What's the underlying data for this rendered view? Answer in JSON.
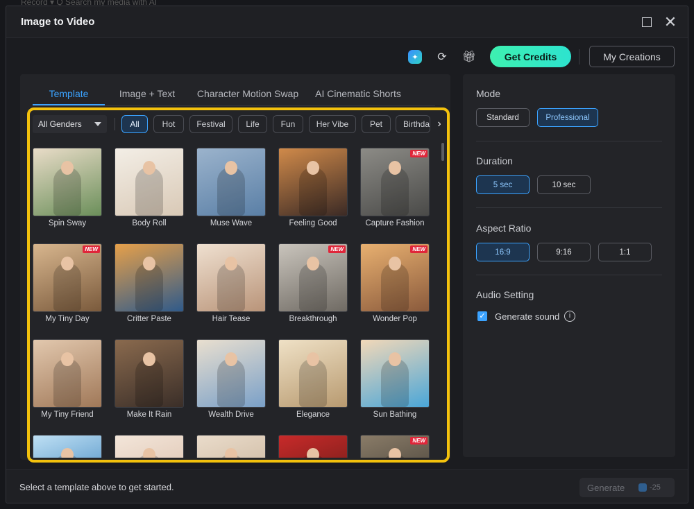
{
  "window": {
    "title": "Image to Video",
    "background_text": "Record ▾    Q  Search my media with AI"
  },
  "toolbar": {
    "credits_label": "Get Credits",
    "creations_label": "My Creations",
    "icons": [
      "ai-sparkle-icon",
      "refresh-icon",
      "gift-icon"
    ]
  },
  "tabs": [
    {
      "label": "Template",
      "active": true
    },
    {
      "label": "Image + Text",
      "active": false
    },
    {
      "label": "Character Motion Swap",
      "active": false
    },
    {
      "label": "AI Cinematic Shorts",
      "active": false
    }
  ],
  "filters": {
    "gender_select": "All Genders",
    "chips": [
      {
        "label": "All",
        "active": true
      },
      {
        "label": "Hot",
        "active": false
      },
      {
        "label": "Festival",
        "active": false
      },
      {
        "label": "Life",
        "active": false
      },
      {
        "label": "Fun",
        "active": false
      },
      {
        "label": "Her Vibe",
        "active": false
      },
      {
        "label": "Pet",
        "active": false
      },
      {
        "label": "Birthday",
        "active": false
      }
    ]
  },
  "templates": [
    {
      "label": "Spin Sway",
      "new": false
    },
    {
      "label": "Body Roll",
      "new": false
    },
    {
      "label": "Muse Wave",
      "new": false
    },
    {
      "label": "Feeling Good",
      "new": false
    },
    {
      "label": "Capture Fashion",
      "new": true
    },
    {
      "label": "My Tiny Day",
      "new": true
    },
    {
      "label": "Critter Paste",
      "new": false
    },
    {
      "label": "Hair Tease",
      "new": false
    },
    {
      "label": "Breakthrough",
      "new": true
    },
    {
      "label": "Wonder Pop",
      "new": true
    },
    {
      "label": "My Tiny Friend",
      "new": false
    },
    {
      "label": "Make It Rain",
      "new": false
    },
    {
      "label": "Wealth Drive",
      "new": false
    },
    {
      "label": "Elegance",
      "new": false
    },
    {
      "label": "Sun Bathing",
      "new": false
    },
    {
      "label": "",
      "new": false
    },
    {
      "label": "",
      "new": false
    },
    {
      "label": "",
      "new": false
    },
    {
      "label": "",
      "new": false
    },
    {
      "label": "",
      "new": true
    }
  ],
  "new_badge": "NEW",
  "settings": {
    "mode": {
      "title": "Mode",
      "options": [
        {
          "label": "Standard",
          "active": false
        },
        {
          "label": "Professional",
          "active": true
        }
      ]
    },
    "duration": {
      "title": "Duration",
      "options": [
        {
          "label": "5 sec",
          "active": true
        },
        {
          "label": "10 sec",
          "active": false
        }
      ]
    },
    "aspect": {
      "title": "Aspect Ratio",
      "options": [
        {
          "label": "16:9",
          "active": true
        },
        {
          "label": "9:16",
          "active": false
        },
        {
          "label": "1:1",
          "active": false
        }
      ]
    },
    "audio": {
      "title": "Audio Setting",
      "checkbox_label": "Generate sound",
      "checked": true
    }
  },
  "footer": {
    "hint": "Select a template above to get started.",
    "generate_label": "Generate",
    "credit_cost": "-25"
  },
  "colors": {
    "accent": "#3ba3ff",
    "credits_gradient_start": "#3ef0b0",
    "highlight": "#f4c20d",
    "new_badge": "#e0263a"
  }
}
